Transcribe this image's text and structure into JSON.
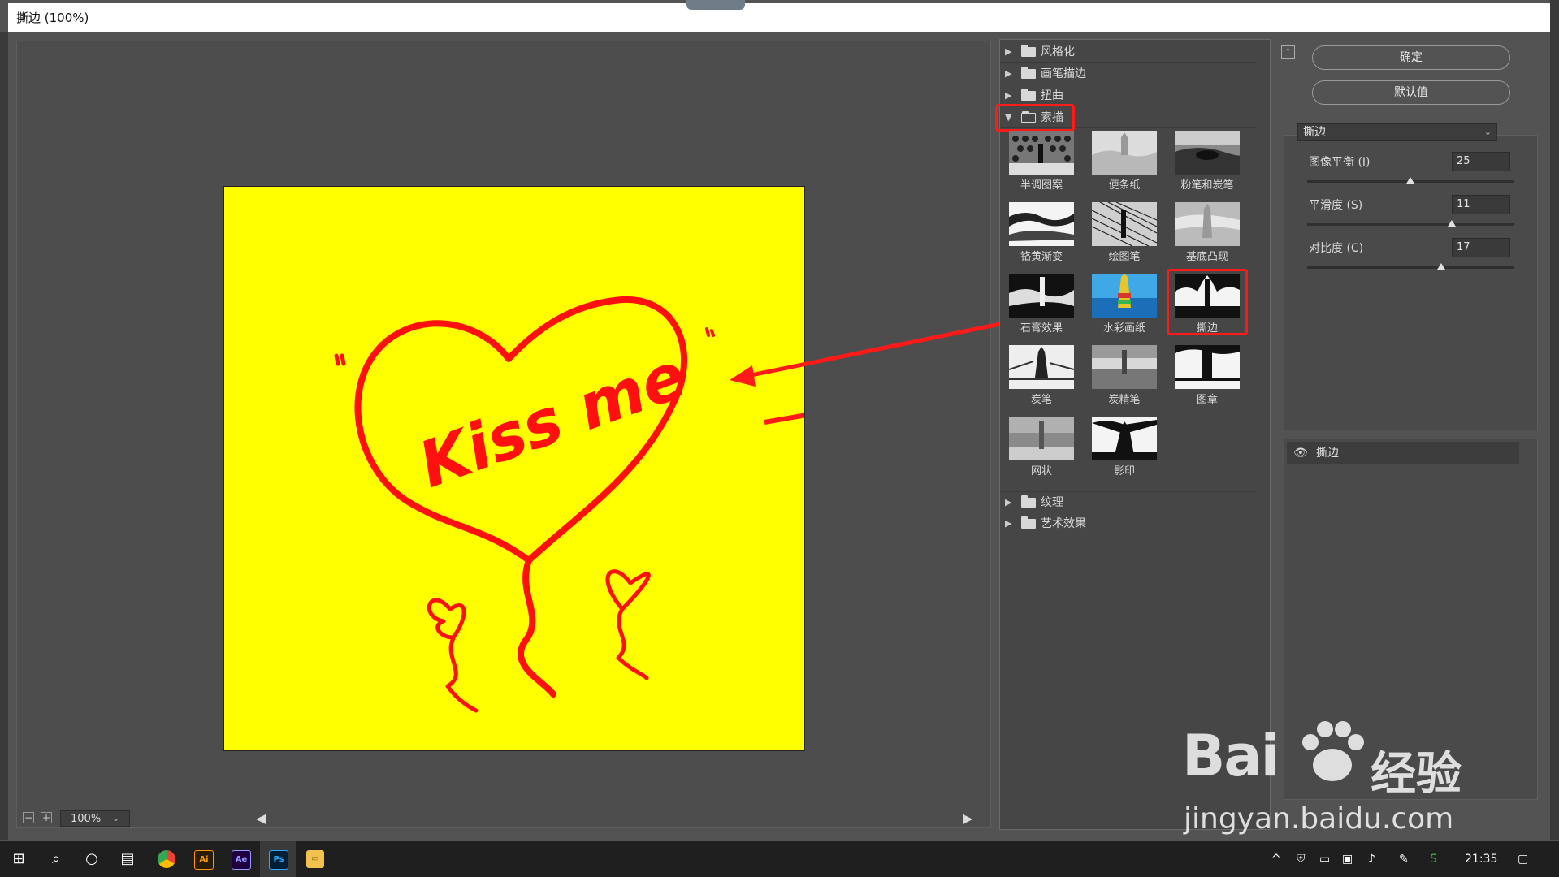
{
  "window": {
    "title": "撕边 (100%)"
  },
  "preview": {
    "zoom": "100%",
    "image_text": "Kiss me",
    "image_bg": "#ffff00",
    "stroke_color": "#ff1010"
  },
  "gallery": {
    "categories_top": [
      {
        "label": "风格化",
        "expanded": false
      },
      {
        "label": "画笔描边",
        "expanded": false
      },
      {
        "label": "扭曲",
        "expanded": false
      },
      {
        "label": "素描",
        "expanded": true
      }
    ],
    "sketch_filters": [
      {
        "label": "半调图案"
      },
      {
        "label": "便条纸"
      },
      {
        "label": "粉笔和炭笔"
      },
      {
        "label": "铬黄渐变"
      },
      {
        "label": "绘图笔"
      },
      {
        "label": "基底凸现"
      },
      {
        "label": "石膏效果"
      },
      {
        "label": "水彩画纸"
      },
      {
        "label": "撕边",
        "selected": true
      },
      {
        "label": "炭笔"
      },
      {
        "label": "炭精笔"
      },
      {
        "label": "图章"
      },
      {
        "label": "网状"
      },
      {
        "label": "影印"
      }
    ],
    "categories_bottom": [
      {
        "label": "纹理",
        "expanded": false
      },
      {
        "label": "艺术效果",
        "expanded": false
      }
    ]
  },
  "settings": {
    "ok_label": "确定",
    "default_label": "默认值",
    "selected_filter": "撕边",
    "params": [
      {
        "label": "图像平衡 (I)",
        "value": "25",
        "fraction": 0.5
      },
      {
        "label": "平滑度 (S)",
        "value": "11",
        "fraction": 0.7
      },
      {
        "label": "对比度 (C)",
        "value": "17",
        "fraction": 0.65
      }
    ]
  },
  "layers": {
    "items": [
      {
        "label": "撕边",
        "visible": true
      }
    ]
  },
  "taskbar": {
    "clock": "21:35",
    "apps": [
      "Chrome",
      "Ai",
      "Ae",
      "Ps",
      "Explorer"
    ]
  },
  "watermark": {
    "logo": "Bai",
    "cn": "经验",
    "url": "jingyan.baidu.com"
  },
  "colors": {
    "highlight_red": "#ff1a1a",
    "panel_bg": "#464646"
  }
}
